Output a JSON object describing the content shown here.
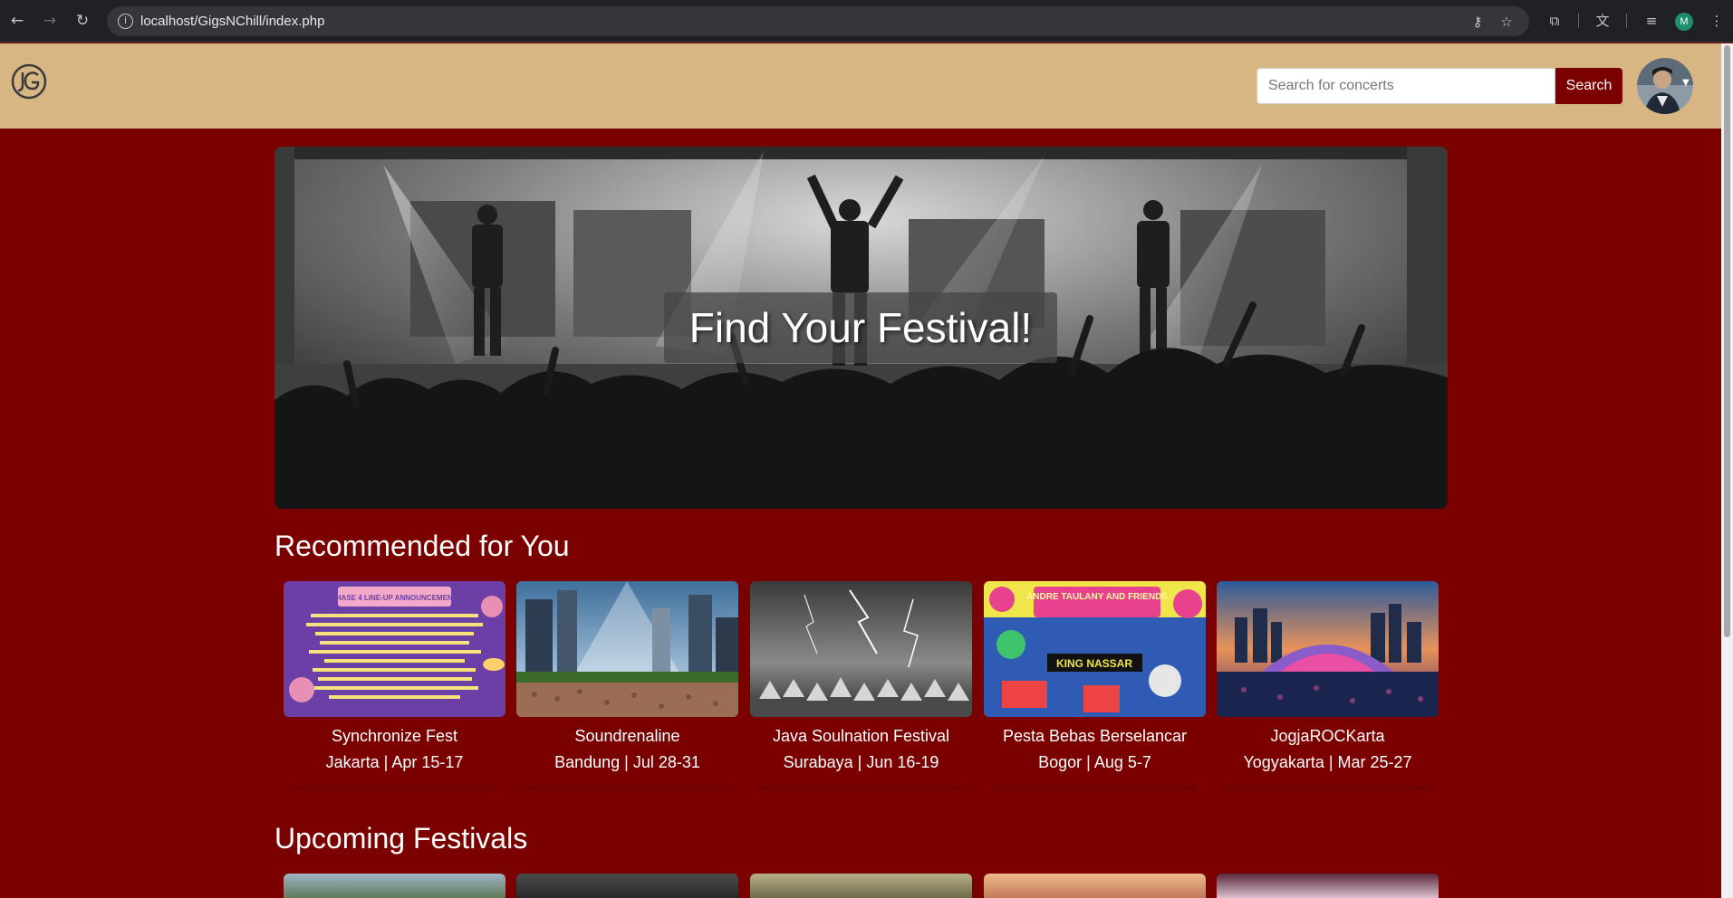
{
  "browser": {
    "url": "localhost/GigsNChill/index.php",
    "profile_initial": "M"
  },
  "header": {
    "search_placeholder": "Search for concerts",
    "search_label": "Search"
  },
  "hero": {
    "title": "Find Your Festival!"
  },
  "recommended": {
    "title": "Recommended for You",
    "items": [
      {
        "name": "Synchronize Fest",
        "meta": "Jakarta | Apr 15-17"
      },
      {
        "name": "Soundrenaline",
        "meta": "Bandung | Jul 28-31"
      },
      {
        "name": "Java Soulnation Festival",
        "meta": "Surabaya | Jun 16-19"
      },
      {
        "name": "Pesta Bebas Berselancar",
        "meta": "Bogor | Aug 5-7"
      },
      {
        "name": "JogjaROCKarta",
        "meta": "Yogyakarta | Mar 25-27"
      }
    ]
  },
  "upcoming": {
    "title": "Upcoming Festivals"
  },
  "poster_text": {
    "synchronize_header": "PHASE 4 LINE-UP ANNOUNCEMENT",
    "pesta_header": "ANDRE TAULANY AND FRIENDS",
    "pesta_sub": "KING NASSAR"
  }
}
